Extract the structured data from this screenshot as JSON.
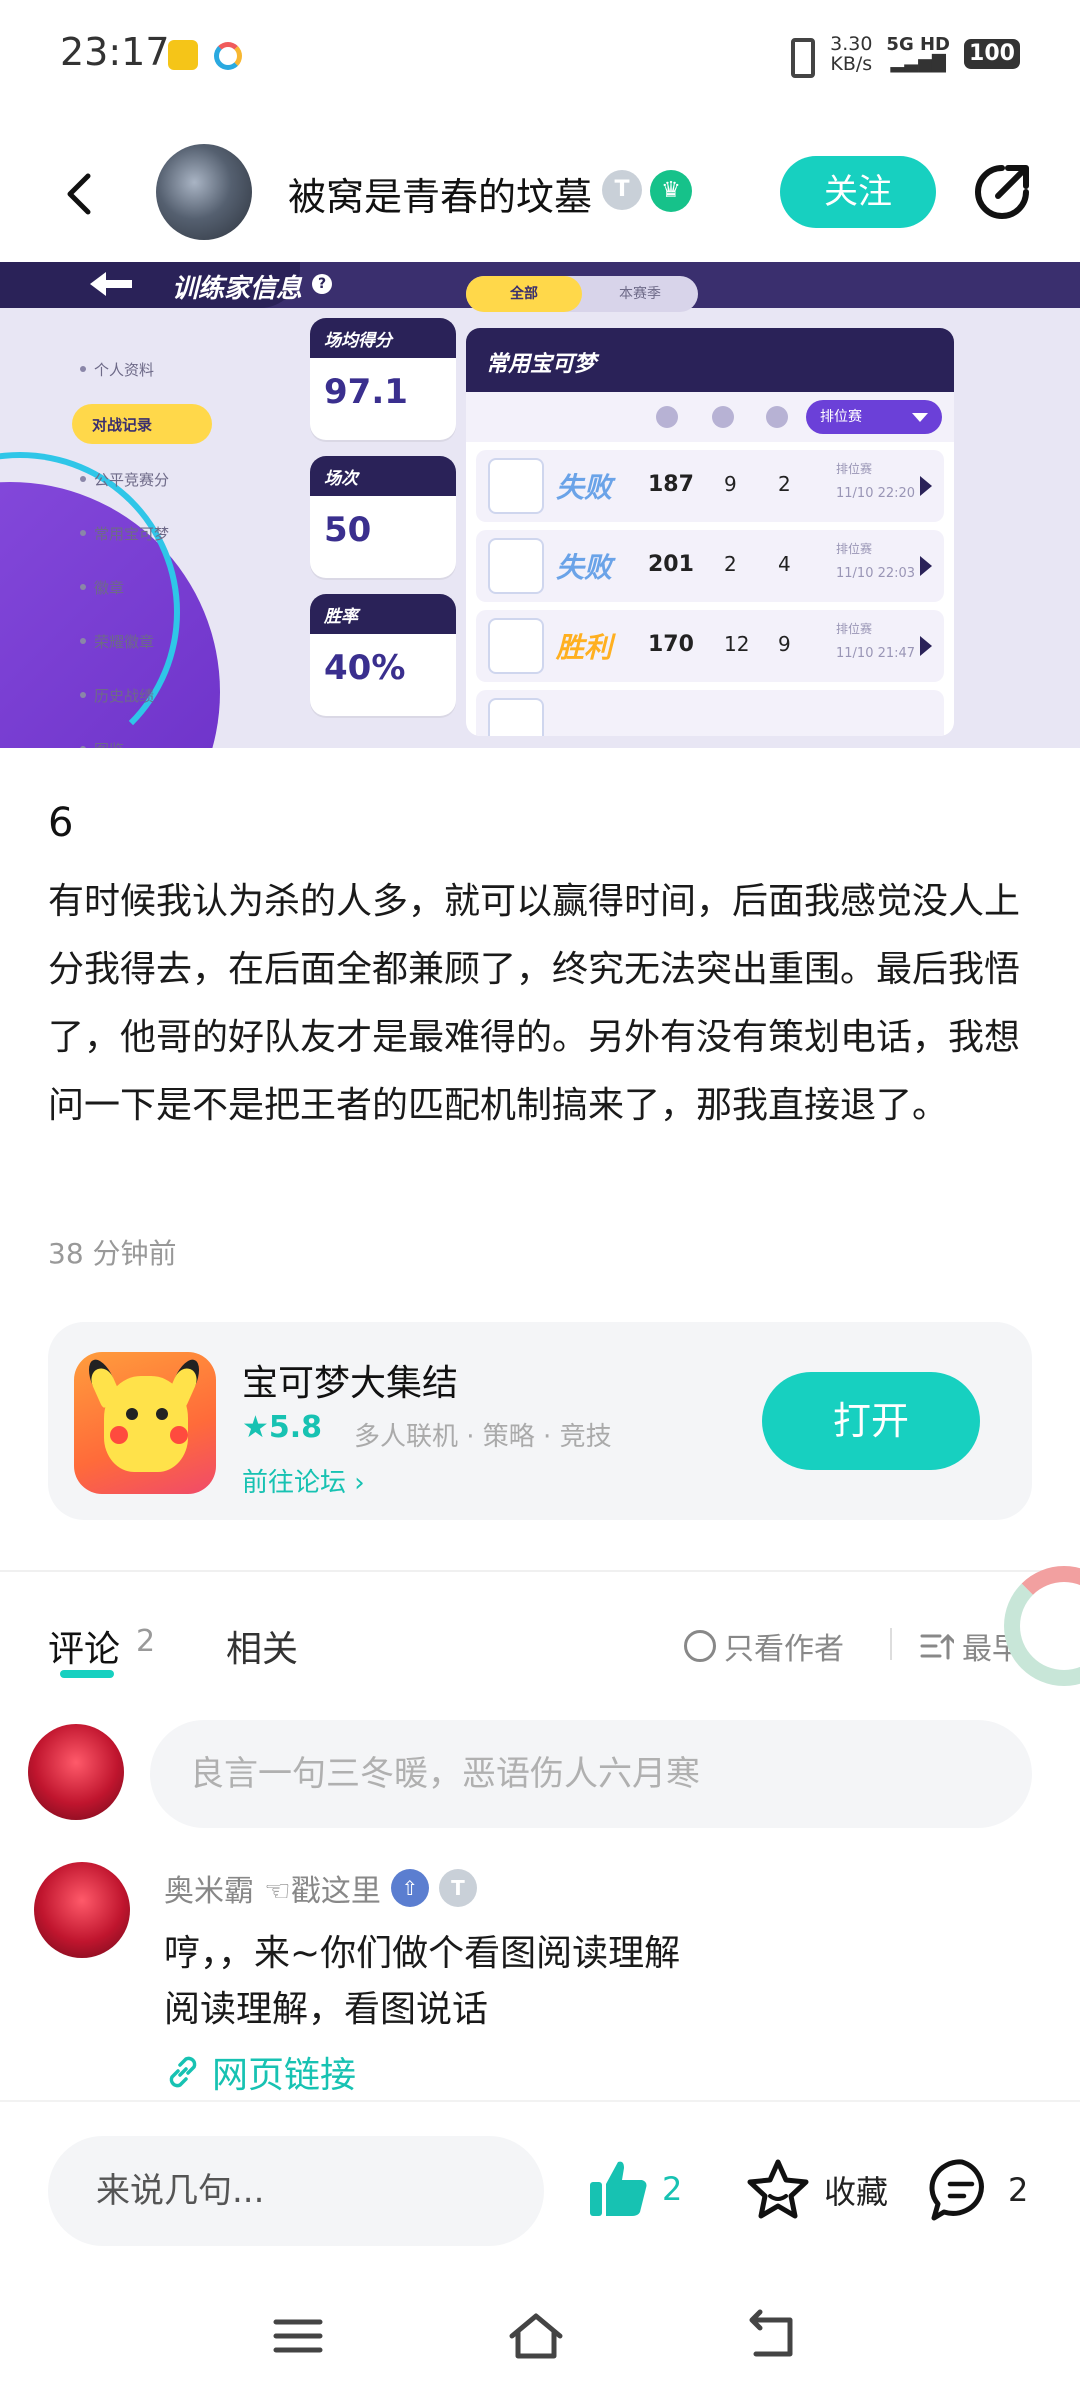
{
  "status_bar": {
    "time": "23:17",
    "net_speed_value": "3.30",
    "net_speed_unit": "KB/s",
    "signal": "5G HD",
    "battery": "100"
  },
  "header": {
    "user_name": "被窝是青春的坟墓",
    "badge_t": "T",
    "follow_label": "关注"
  },
  "screenshot": {
    "title": "训练家信息",
    "menu": [
      "个人资料",
      "对战记录",
      "公平竞赛分",
      "常用宝可梦",
      "徽章",
      "荣耀徽章",
      "历史战绩",
      "图鉴"
    ],
    "active_menu_index": 1,
    "stats": [
      {
        "label": "场均得分",
        "value": "97.1"
      },
      {
        "label": "场次",
        "value": "50"
      },
      {
        "label": "胜率",
        "value": "40%"
      }
    ],
    "tabs": [
      "全部",
      "本赛季"
    ],
    "panel_title": "常用宝可梦",
    "filter": "排位赛",
    "matches": [
      {
        "result": "失败",
        "score": "187",
        "k": "9",
        "a": "2",
        "mode": "排位赛",
        "time": "11/10 22:20"
      },
      {
        "result": "失败",
        "score": "201",
        "k": "2",
        "a": "4",
        "mode": "排位赛",
        "time": "11/10 22:03"
      },
      {
        "result": "胜利",
        "score": "170",
        "k": "12",
        "a": "9",
        "mode": "排位赛",
        "time": "11/10 21:47"
      }
    ]
  },
  "post": {
    "index": "6",
    "text": "有时候我认为杀的人多，就可以赢得时间，后面我感觉没人上分我得去，在后面全都兼顾了，终究无法突出重围。最后我悟了，他哥的好队友才是最难得的。另外有没有策划电话，我想问一下是不是把王者的匹配机制搞来了，那我直接退了。",
    "time": "38 分钟前"
  },
  "game_card": {
    "name": "宝可梦大集结",
    "rating": "★5.8",
    "tags": "多人联机 · 策略 · 竞技",
    "forum_link": "前往论坛 ›",
    "open_label": "打开"
  },
  "comments_section": {
    "tab_comment": "评论",
    "comment_count": "2",
    "tab_related": "相关",
    "author_only": "只看作者",
    "sort_label": "最早",
    "input_placeholder": "良言一句三冬暖，恶语伤人六月寒"
  },
  "comment": {
    "user": "奥米霸",
    "user_suffix": "☜戳这里",
    "badge_t": "T",
    "line1": "哼，，来~你们做个看图阅读理解",
    "line2": "阅读理解，看图说话",
    "link_text": "网页链接"
  },
  "action_bar": {
    "input_placeholder": "来说几句...",
    "like_count": "2",
    "favorite_label": "收藏",
    "comment_count": "2"
  },
  "colors": {
    "accent": "#17d0c0",
    "accent_text": "#17c2b2",
    "panel_dark": "#2a2258"
  }
}
